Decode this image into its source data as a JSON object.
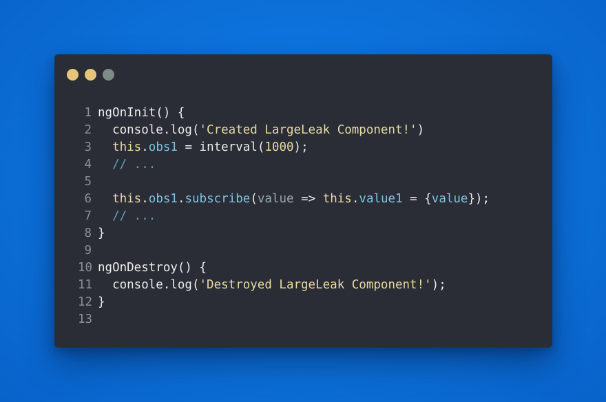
{
  "window": {
    "dots": [
      {
        "name": "close",
        "color": "#e6c57a"
      },
      {
        "name": "minimize",
        "color": "#e6c57a"
      },
      {
        "name": "maximize",
        "color": "#7c8c84"
      }
    ]
  },
  "code": {
    "lines": [
      {
        "num": "1",
        "tokens": [
          {
            "text": "ngOnInit() {",
            "kind": "def"
          }
        ]
      },
      {
        "num": "2",
        "tokens": [
          {
            "text": "  console.log(",
            "kind": "def"
          },
          {
            "text": "'Created LargeLeak Component!'",
            "kind": "str"
          },
          {
            "text": ")",
            "kind": "def"
          }
        ]
      },
      {
        "num": "3",
        "tokens": [
          {
            "text": "  ",
            "kind": "def"
          },
          {
            "text": "this",
            "kind": "kw"
          },
          {
            "text": ".",
            "kind": "def"
          },
          {
            "text": "obs1",
            "kind": "prop"
          },
          {
            "text": " = interval(",
            "kind": "def"
          },
          {
            "text": "1000",
            "kind": "str"
          },
          {
            "text": ");",
            "kind": "def"
          }
        ]
      },
      {
        "num": "4",
        "tokens": [
          {
            "text": "  // ...",
            "kind": "comment"
          }
        ]
      },
      {
        "num": "5",
        "tokens": [
          {
            "text": "",
            "kind": "def"
          }
        ]
      },
      {
        "num": "6",
        "tokens": [
          {
            "text": "  ",
            "kind": "def"
          },
          {
            "text": "this",
            "kind": "kw"
          },
          {
            "text": ".",
            "kind": "def"
          },
          {
            "text": "obs1",
            "kind": "prop"
          },
          {
            "text": ".",
            "kind": "def"
          },
          {
            "text": "subscribe",
            "kind": "prop"
          },
          {
            "text": "(",
            "kind": "def"
          },
          {
            "text": "value",
            "kind": "param"
          },
          {
            "text": " => ",
            "kind": "def"
          },
          {
            "text": "this",
            "kind": "kw"
          },
          {
            "text": ".",
            "kind": "def"
          },
          {
            "text": "value1",
            "kind": "prop"
          },
          {
            "text": " = {",
            "kind": "def"
          },
          {
            "text": "value",
            "kind": "prop"
          },
          {
            "text": "});",
            "kind": "def"
          }
        ]
      },
      {
        "num": "7",
        "tokens": [
          {
            "text": "  // ...",
            "kind": "comment"
          }
        ]
      },
      {
        "num": "8",
        "tokens": [
          {
            "text": "}",
            "kind": "def"
          }
        ]
      },
      {
        "num": "9",
        "tokens": [
          {
            "text": "",
            "kind": "def"
          }
        ]
      },
      {
        "num": "10",
        "tokens": [
          {
            "text": "ngOnDestroy() {",
            "kind": "def"
          }
        ]
      },
      {
        "num": "11",
        "tokens": [
          {
            "text": "  console.log(",
            "kind": "def"
          },
          {
            "text": "'Destroyed LargeLeak Component!'",
            "kind": "str"
          },
          {
            "text": ");",
            "kind": "def"
          }
        ]
      },
      {
        "num": "12",
        "tokens": [
          {
            "text": "}",
            "kind": "def"
          }
        ]
      },
      {
        "num": "13",
        "tokens": [
          {
            "text": "",
            "kind": "def"
          }
        ]
      }
    ]
  }
}
